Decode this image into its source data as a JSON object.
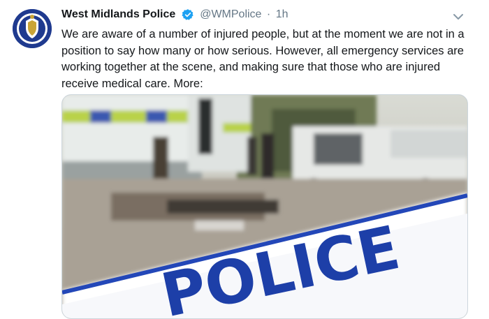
{
  "tweet": {
    "author_name": "West Midlands Police",
    "handle": "@WMPolice",
    "separator": "·",
    "time": "1h",
    "text": "We are aware of a number of injured people, but at the moment we are not in a position to say how many or how serious. However, all emergency services are working together at the scene, and making sure that those who are injured receive medical care. More:",
    "verified_icon": "verified-badge-icon",
    "caret_icon": "chevron-down-icon",
    "media": {
      "tape_text": "POLICE"
    }
  },
  "colors": {
    "verified": "#1da1f2",
    "secondary_text": "#657786",
    "tape_text": "#1d3fa8",
    "avatar_bg": "#1f3a8f"
  }
}
